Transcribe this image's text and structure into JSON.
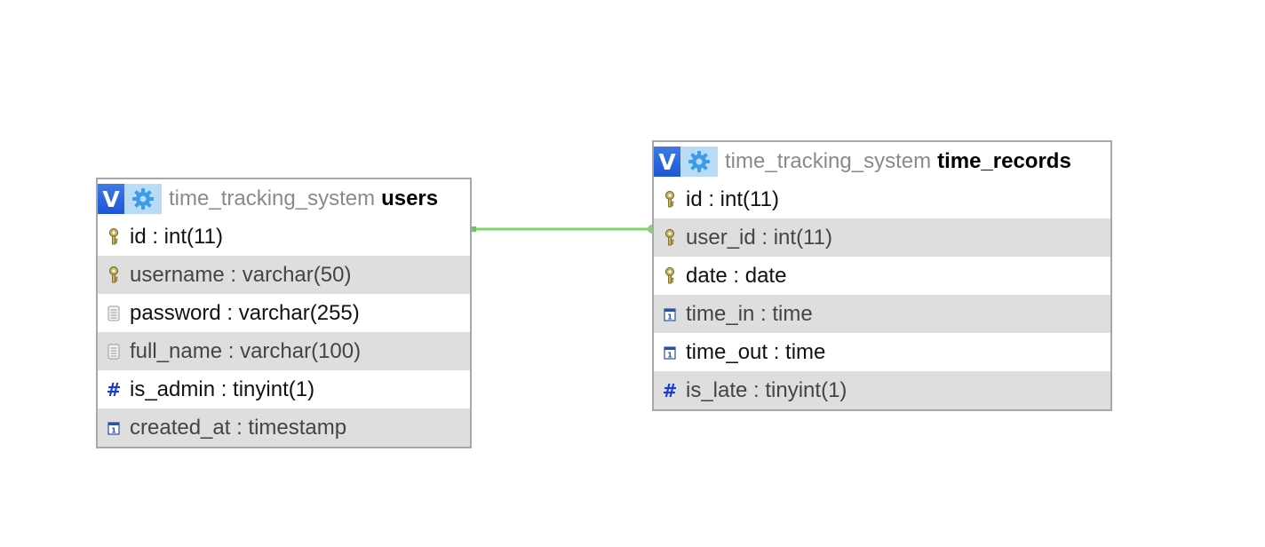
{
  "tables": [
    {
      "id": "users",
      "database": "time_tracking_system",
      "name": "users",
      "v_label": "V",
      "columns": [
        {
          "text": "id : int(11)",
          "icon": "key-icon"
        },
        {
          "text": "username : varchar(50)",
          "icon": "key-icon"
        },
        {
          "text": "password : varchar(255)",
          "icon": "text-column-icon"
        },
        {
          "text": "full_name : varchar(100)",
          "icon": "text-column-icon"
        },
        {
          "text": "is_admin : tinyint(1)",
          "icon": "numeric-hash-icon"
        },
        {
          "text": "created_at : timestamp",
          "icon": "datetime-icon"
        }
      ]
    },
    {
      "id": "time_records",
      "database": "time_tracking_system",
      "name": "time_records",
      "v_label": "V",
      "columns": [
        {
          "text": "id : int(11)",
          "icon": "key-icon"
        },
        {
          "text": "user_id : int(11)",
          "icon": "key-icon"
        },
        {
          "text": "date : date",
          "icon": "key-icon"
        },
        {
          "text": "time_in : time",
          "icon": "datetime-icon"
        },
        {
          "text": "time_out : time",
          "icon": "datetime-icon"
        },
        {
          "text": "is_late : tinyint(1)",
          "icon": "numeric-hash-icon"
        }
      ]
    }
  ],
  "relations": [
    {
      "from_table": "users",
      "from_column": "id",
      "to_table": "time_records",
      "to_column": "user_id"
    }
  ],
  "colors": {
    "relation_line": "#7fd66f",
    "header_v_button": "#2a63e0",
    "header_gear_button": "#b8dcf6",
    "gear_icon": "#3d9be9",
    "row_alt_background": "#dedede",
    "table_border": "#a8a8a8",
    "database_name_text": "#8a8a8a",
    "hash_icon": "#1a3ad0"
  }
}
